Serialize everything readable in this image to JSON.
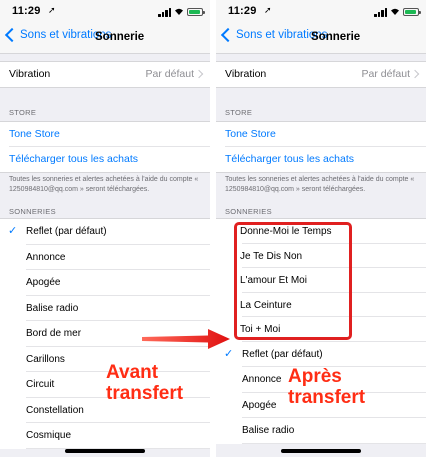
{
  "status_bar": {
    "time": "11:29",
    "location_icon": "location-arrow-icon"
  },
  "nav": {
    "back_label": "Sons et vibrations",
    "title": "Sonnerie"
  },
  "vibration": {
    "label": "Vibration",
    "value": "Par défaut"
  },
  "store": {
    "header": "STORE",
    "tone_store": "Tone Store",
    "download_all": "Télécharger tous les achats",
    "footer": "Toutes les sonneries et alertes achetées à l'aide du compte « 1250984810@qq.com » seront téléchargées."
  },
  "ringtones_header": "SONNERIES",
  "before_list": [
    "Reflet (par défaut)",
    "Annonce",
    "Apogée",
    "Balise radio",
    "Bord de mer",
    "Carillons",
    "Circuit",
    "Constellation",
    "Cosmique"
  ],
  "new_tones": [
    "Donne-Moi le Temps",
    "Je Te Dis Non",
    "L'amour Et Moi",
    "La Ceinture",
    "Toi + Moi"
  ],
  "after_list": [
    "Reflet (par défaut)",
    "Annonce",
    "Apogée",
    "Balise radio"
  ],
  "selected_tone": "Reflet (par défaut)",
  "labels": {
    "before": "Avant transfert",
    "after": "Après transfert"
  },
  "colors": {
    "accent": "#007aff",
    "annotation": "#ff2d14",
    "highlight": "#e02020"
  }
}
